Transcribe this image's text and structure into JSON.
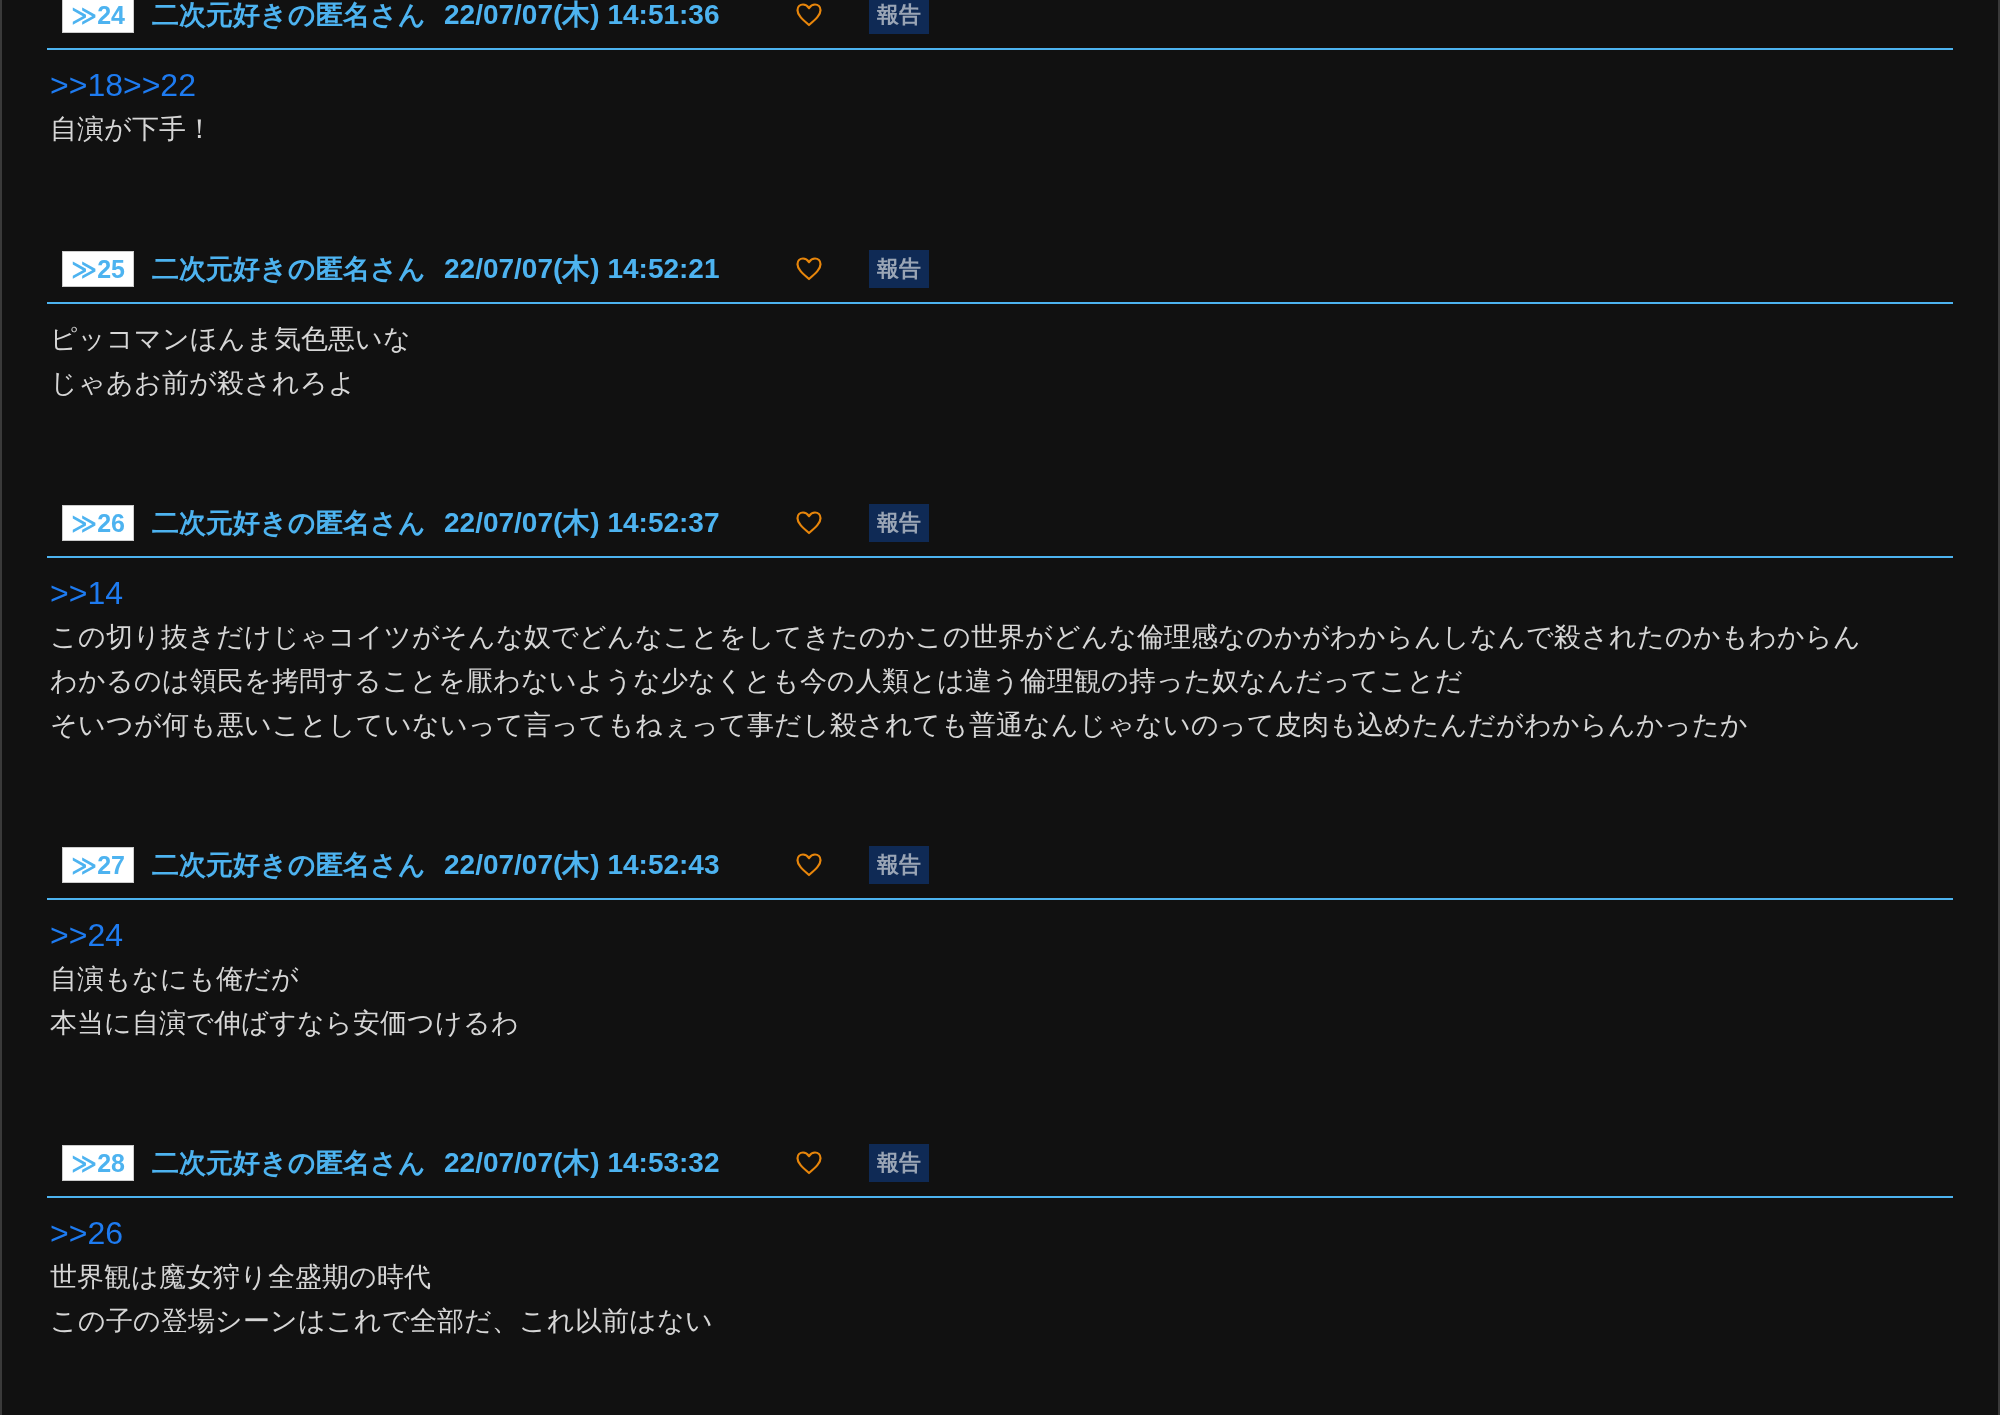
{
  "posts": [
    {
      "number": "≫24",
      "name": "二次元好きの匿名さん",
      "date": "22/07/07(木) 14:51:36",
      "report": "報告",
      "anchor": ">>18>>22",
      "lines": [
        "自演が下手！"
      ]
    },
    {
      "number": "≫25",
      "name": "二次元好きの匿名さん",
      "date": "22/07/07(木) 14:52:21",
      "report": "報告",
      "lines": [
        "ピッコマンほんま気色悪いな",
        "じゃあお前が殺されろよ"
      ]
    },
    {
      "number": "≫26",
      "name": "二次元好きの匿名さん",
      "date": "22/07/07(木) 14:52:37",
      "report": "報告",
      "anchor": ">>14",
      "lines": [
        "この切り抜きだけじゃコイツがそんな奴でどんなことをしてきたのかこの世界がどんな倫理感なのかがわからんしなんで殺されたのかもわからん",
        "わかるのは領民を拷問することを厭わないような少なくとも今の人類とは違う倫理観の持った奴なんだってことだ",
        "そいつが何も悪いことしていないって言ってもねぇって事だし殺されても普通なんじゃないのって皮肉も込めたんだがわからんかったか"
      ]
    },
    {
      "number": "≫27",
      "name": "二次元好きの匿名さん",
      "date": "22/07/07(木) 14:52:43",
      "report": "報告",
      "anchor": ">>24",
      "lines": [
        "自演もなにも俺だが",
        "本当に自演で伸ばすなら安価つけるわ"
      ]
    },
    {
      "number": "≫28",
      "name": "二次元好きの匿名さん",
      "date": "22/07/07(木) 14:53:32",
      "report": "報告",
      "anchor": ">>26",
      "lines": [
        "世界観は魔女狩り全盛期の時代",
        "この子の登場シーンはこれで全部だ、これ以前はない"
      ]
    }
  ]
}
